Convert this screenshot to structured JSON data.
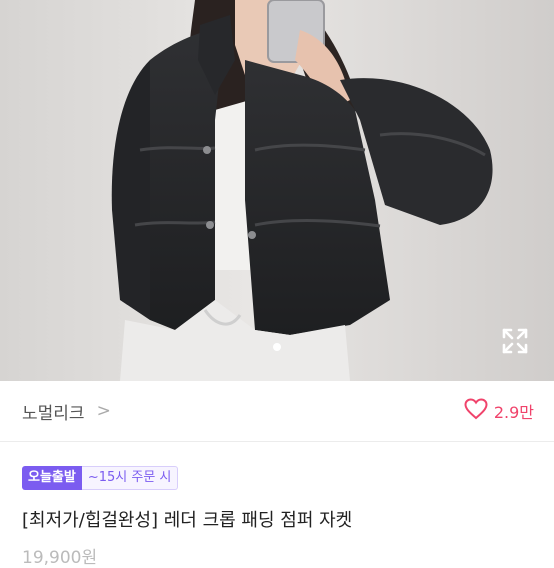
{
  "hero": {
    "image_desc_icon": "product-photo",
    "expand_icon": "expand-icon",
    "dots_total": 1,
    "active_dot": 0
  },
  "shop": {
    "name": "노멀리크",
    "chevron": ">",
    "like_count": "2.9만"
  },
  "product": {
    "badge_label": "오늘출발",
    "badge_condition": "~15시 주문 시",
    "title": "[최저가/힙걸완성] 레더 크롭 패딩 점퍼 자켓",
    "price_partial": "19,900원"
  },
  "colors": {
    "accent_purple": "#7b5cf0",
    "like_pink": "#f0436b"
  }
}
